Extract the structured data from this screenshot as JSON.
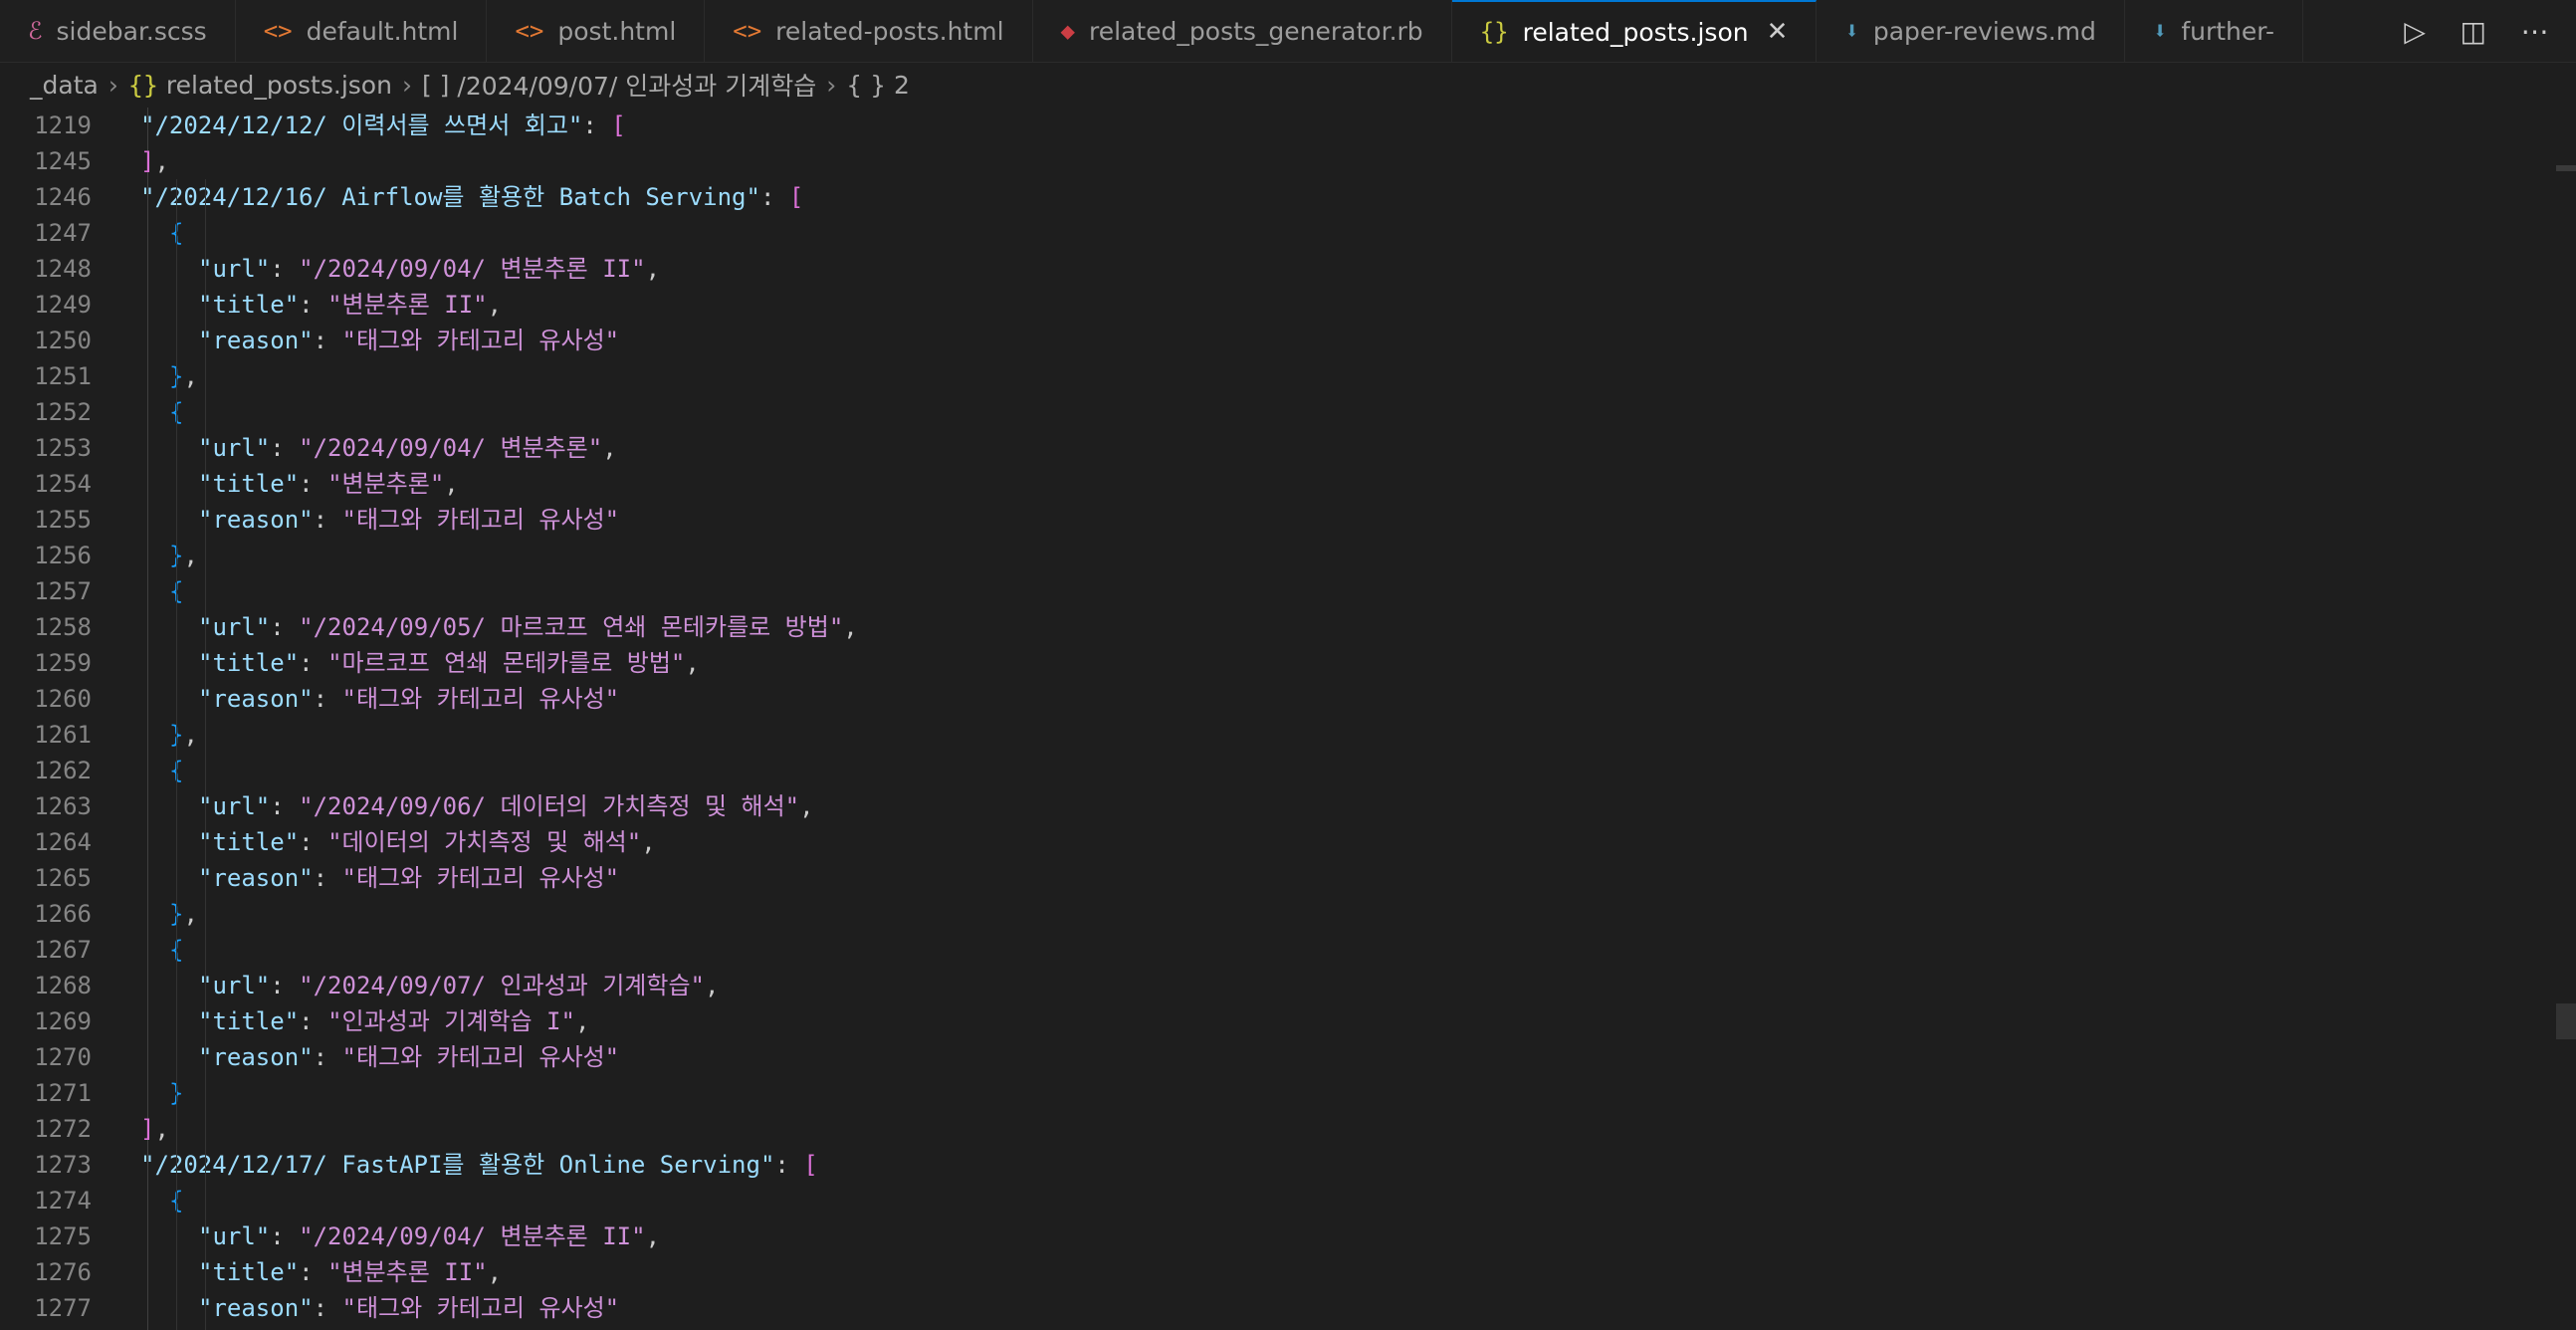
{
  "tabs": [
    {
      "icon": "sass-icon",
      "glyph": "ℰ",
      "color": "#cd6799",
      "label": "sidebar.scss"
    },
    {
      "icon": "html-icon",
      "glyph": "<>",
      "color": "#e37933",
      "label": "default.html"
    },
    {
      "icon": "html-icon",
      "glyph": "<>",
      "color": "#e37933",
      "label": "post.html"
    },
    {
      "icon": "html-icon",
      "glyph": "<>",
      "color": "#e37933",
      "label": "related-posts.html"
    },
    {
      "icon": "ruby-icon",
      "glyph": "◆",
      "color": "#cc3e44",
      "label": "related_posts_generator.rb"
    },
    {
      "icon": "json-icon",
      "glyph": "{}",
      "color": "#cbcb41",
      "label": "related_posts.json",
      "active": true
    },
    {
      "icon": "markdown-icon",
      "glyph": "⬇",
      "color": "#519aba",
      "label": "paper-reviews.md"
    },
    {
      "icon": "markdown-icon",
      "glyph": "⬇",
      "color": "#519aba",
      "label": "further-"
    }
  ],
  "breadcrumb": {
    "folder": "_data",
    "file": "related_posts.json",
    "array_icon": "[ ]",
    "array_label": "/2024/09/07/ 인과성과 기계학습",
    "object_icon": "{ }",
    "object_label": "2"
  },
  "lines": [
    {
      "n": "1219",
      "indent": 1,
      "type": "keyarr",
      "key": "/2024/12/12/ 이력서를 쓰면서 회고"
    },
    {
      "n": "1245",
      "indent": 1,
      "type": "closearr",
      "comma": true
    },
    {
      "n": "1246",
      "indent": 1,
      "type": "keyarr",
      "key": "/2024/12/16/ Airflow를 활용한 Batch Serving"
    },
    {
      "n": "1247",
      "indent": 2,
      "type": "openobj"
    },
    {
      "n": "1248",
      "indent": 3,
      "type": "kv",
      "key": "url",
      "value": "/2024/09/04/ 변분추론 II",
      "comma": true
    },
    {
      "n": "1249",
      "indent": 3,
      "type": "kv",
      "key": "title",
      "value": "변분추론 II",
      "comma": true
    },
    {
      "n": "1250",
      "indent": 3,
      "type": "kv",
      "key": "reason",
      "value": "태그와 카테고리 유사성"
    },
    {
      "n": "1251",
      "indent": 2,
      "type": "closeobj",
      "comma": true
    },
    {
      "n": "1252",
      "indent": 2,
      "type": "openobj"
    },
    {
      "n": "1253",
      "indent": 3,
      "type": "kv",
      "key": "url",
      "value": "/2024/09/04/ 변분추론",
      "comma": true
    },
    {
      "n": "1254",
      "indent": 3,
      "type": "kv",
      "key": "title",
      "value": "변분추론",
      "comma": true
    },
    {
      "n": "1255",
      "indent": 3,
      "type": "kv",
      "key": "reason",
      "value": "태그와 카테고리 유사성"
    },
    {
      "n": "1256",
      "indent": 2,
      "type": "closeobj",
      "comma": true
    },
    {
      "n": "1257",
      "indent": 2,
      "type": "openobj"
    },
    {
      "n": "1258",
      "indent": 3,
      "type": "kv",
      "key": "url",
      "value": "/2024/09/05/ 마르코프 연쇄 몬테카를로 방법",
      "comma": true
    },
    {
      "n": "1259",
      "indent": 3,
      "type": "kv",
      "key": "title",
      "value": "마르코프 연쇄 몬테카를로 방법",
      "comma": true
    },
    {
      "n": "1260",
      "indent": 3,
      "type": "kv",
      "key": "reason",
      "value": "태그와 카테고리 유사성"
    },
    {
      "n": "1261",
      "indent": 2,
      "type": "closeobj",
      "comma": true
    },
    {
      "n": "1262",
      "indent": 2,
      "type": "openobj"
    },
    {
      "n": "1263",
      "indent": 3,
      "type": "kv",
      "key": "url",
      "value": "/2024/09/06/ 데이터의 가치측정 및 해석",
      "comma": true
    },
    {
      "n": "1264",
      "indent": 3,
      "type": "kv",
      "key": "title",
      "value": "데이터의 가치측정 및 해석",
      "comma": true
    },
    {
      "n": "1265",
      "indent": 3,
      "type": "kv",
      "key": "reason",
      "value": "태그와 카테고리 유사성"
    },
    {
      "n": "1266",
      "indent": 2,
      "type": "closeobj",
      "comma": true
    },
    {
      "n": "1267",
      "indent": 2,
      "type": "openobj"
    },
    {
      "n": "1268",
      "indent": 3,
      "type": "kv",
      "key": "url",
      "value": "/2024/09/07/ 인과성과 기계학습",
      "comma": true
    },
    {
      "n": "1269",
      "indent": 3,
      "type": "kv",
      "key": "title",
      "value": "인과성과 기계학습 I",
      "comma": true
    },
    {
      "n": "1270",
      "indent": 3,
      "type": "kv",
      "key": "reason",
      "value": "태그와 카테고리 유사성"
    },
    {
      "n": "1271",
      "indent": 2,
      "type": "closeobj"
    },
    {
      "n": "1272",
      "indent": 1,
      "type": "closearr",
      "comma": true
    },
    {
      "n": "1273",
      "indent": 1,
      "type": "keyarr",
      "key": "/2024/12/17/ FastAPI를 활용한 Online Serving"
    },
    {
      "n": "1274",
      "indent": 2,
      "type": "openobj"
    },
    {
      "n": "1275",
      "indent": 3,
      "type": "kv",
      "key": "url",
      "value": "/2024/09/04/ 변분추론 II",
      "comma": true
    },
    {
      "n": "1276",
      "indent": 3,
      "type": "kv",
      "key": "title",
      "value": "변분추론 II",
      "comma": true
    },
    {
      "n": "1277",
      "indent": 3,
      "type": "kv",
      "key": "reason",
      "value": "태그와 카테고리 유사성"
    }
  ]
}
